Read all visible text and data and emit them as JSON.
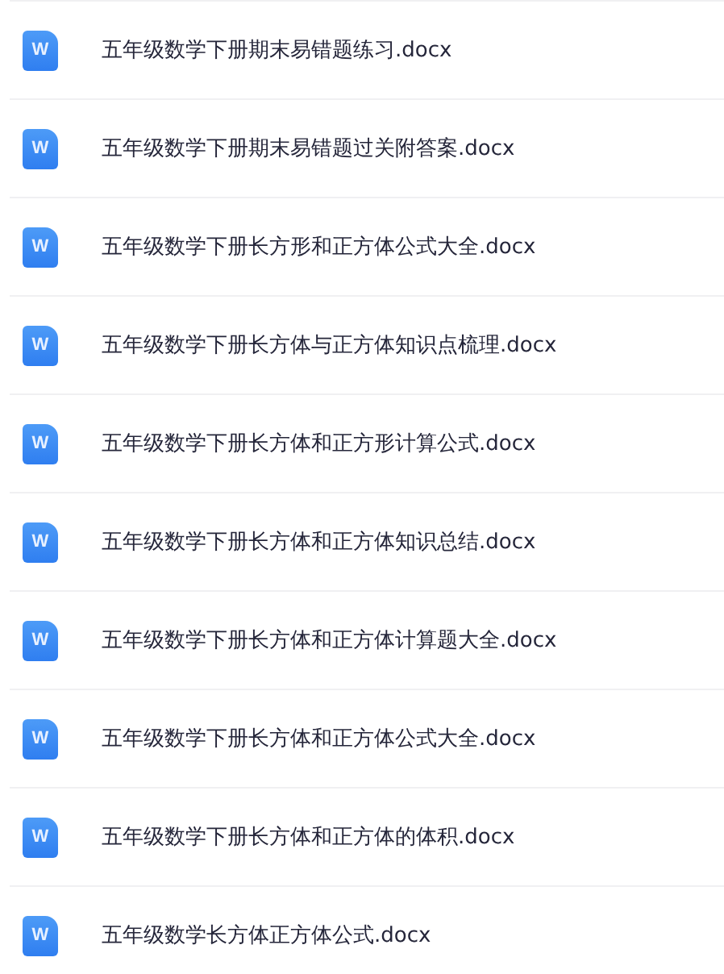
{
  "files": [
    {
      "icon": "W",
      "name": "五年级数学下册期末易错题练习.docx"
    },
    {
      "icon": "W",
      "name": "五年级数学下册期末易错题过关附答案.docx"
    },
    {
      "icon": "W",
      "name": "五年级数学下册长方形和正方体公式大全.docx"
    },
    {
      "icon": "W",
      "name": "五年级数学下册长方体与正方体知识点梳理.docx"
    },
    {
      "icon": "W",
      "name": "五年级数学下册长方体和正方形计算公式.docx"
    },
    {
      "icon": "W",
      "name": "五年级数学下册长方体和正方体知识总结.docx"
    },
    {
      "icon": "W",
      "name": "五年级数学下册长方体和正方体计算题大全.docx"
    },
    {
      "icon": "W",
      "name": "五年级数学下册长方体和正方体公式大全.docx"
    },
    {
      "icon": "W",
      "name": "五年级数学下册长方体和正方体的体积.docx"
    },
    {
      "icon": "W",
      "name": "五年级数学长方体正方体公式.docx"
    }
  ]
}
